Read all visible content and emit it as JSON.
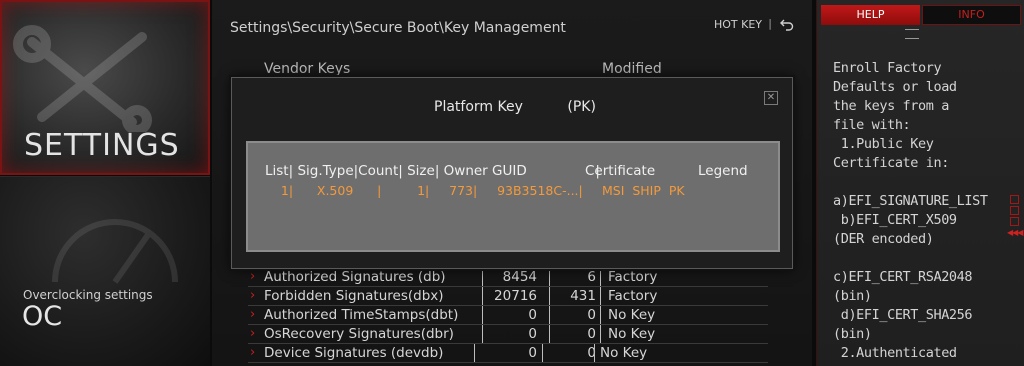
{
  "left_tiles": {
    "settings": {
      "label": "SETTINGS"
    },
    "oc": {
      "subtitle": "Overclocking settings",
      "label": "OC"
    }
  },
  "header": {
    "breadcrumb": "Settings\\Security\\Secure Boot\\Key Management",
    "hotkey_label": "HOT KEY",
    "separator": "|",
    "back_icon": "back-arrow-icon"
  },
  "list_columns": {
    "vendor": "Vendor Keys",
    "modified": "Modified"
  },
  "rows": [
    {
      "name": "Authorized Signatures (db)",
      "n1": "8454",
      "n2": "6",
      "status": "Factory"
    },
    {
      "name": "Forbidden   Signatures(dbx)",
      "n1": "20716",
      "n2": "431",
      "status": "Factory"
    },
    {
      "name": "Authorized TimeStamps(dbt)",
      "n1": "0",
      "n2": "0",
      "status": "No Key"
    },
    {
      "name": "OsRecovery Signatures(dbr)",
      "n1": "0",
      "n2": "0",
      "status": "No Key"
    },
    {
      "name": "Device Signatures      (devdb)",
      "n1": "0",
      "n2": "0",
      "status": "No Key"
    }
  ],
  "modal": {
    "title": "Platform Key          (PK)",
    "close_icon": "close-icon",
    "table_header": "List| Sig.Type|Count| Size| Owner GUID                |",
    "table_header_cert": "Certificate",
    "table_header_legend": "Legend",
    "entry": "    1|      X.509      |         1|     773|     93B3518C-...|",
    "entry_cert": "MSI  SHIP  PK"
  },
  "help": {
    "tab_help": "HELP",
    "tab_info": "INFO",
    "text": "Enroll Factory\nDefaults or load\nthe keys from a\nfile with:\n 1.Public Key\nCertificate in:\n\na)EFI_SIGNATURE_LIST\n b)EFI_CERT_X509\n(DER encoded)\n\nc)EFI_CERT_RSA2048\n(bin)\n d)EFI_CERT_SHA256\n(bin)\n 2.Authenticated"
  },
  "colors": {
    "accent_red": "#c01818",
    "orange_text": "#f39a3c"
  }
}
